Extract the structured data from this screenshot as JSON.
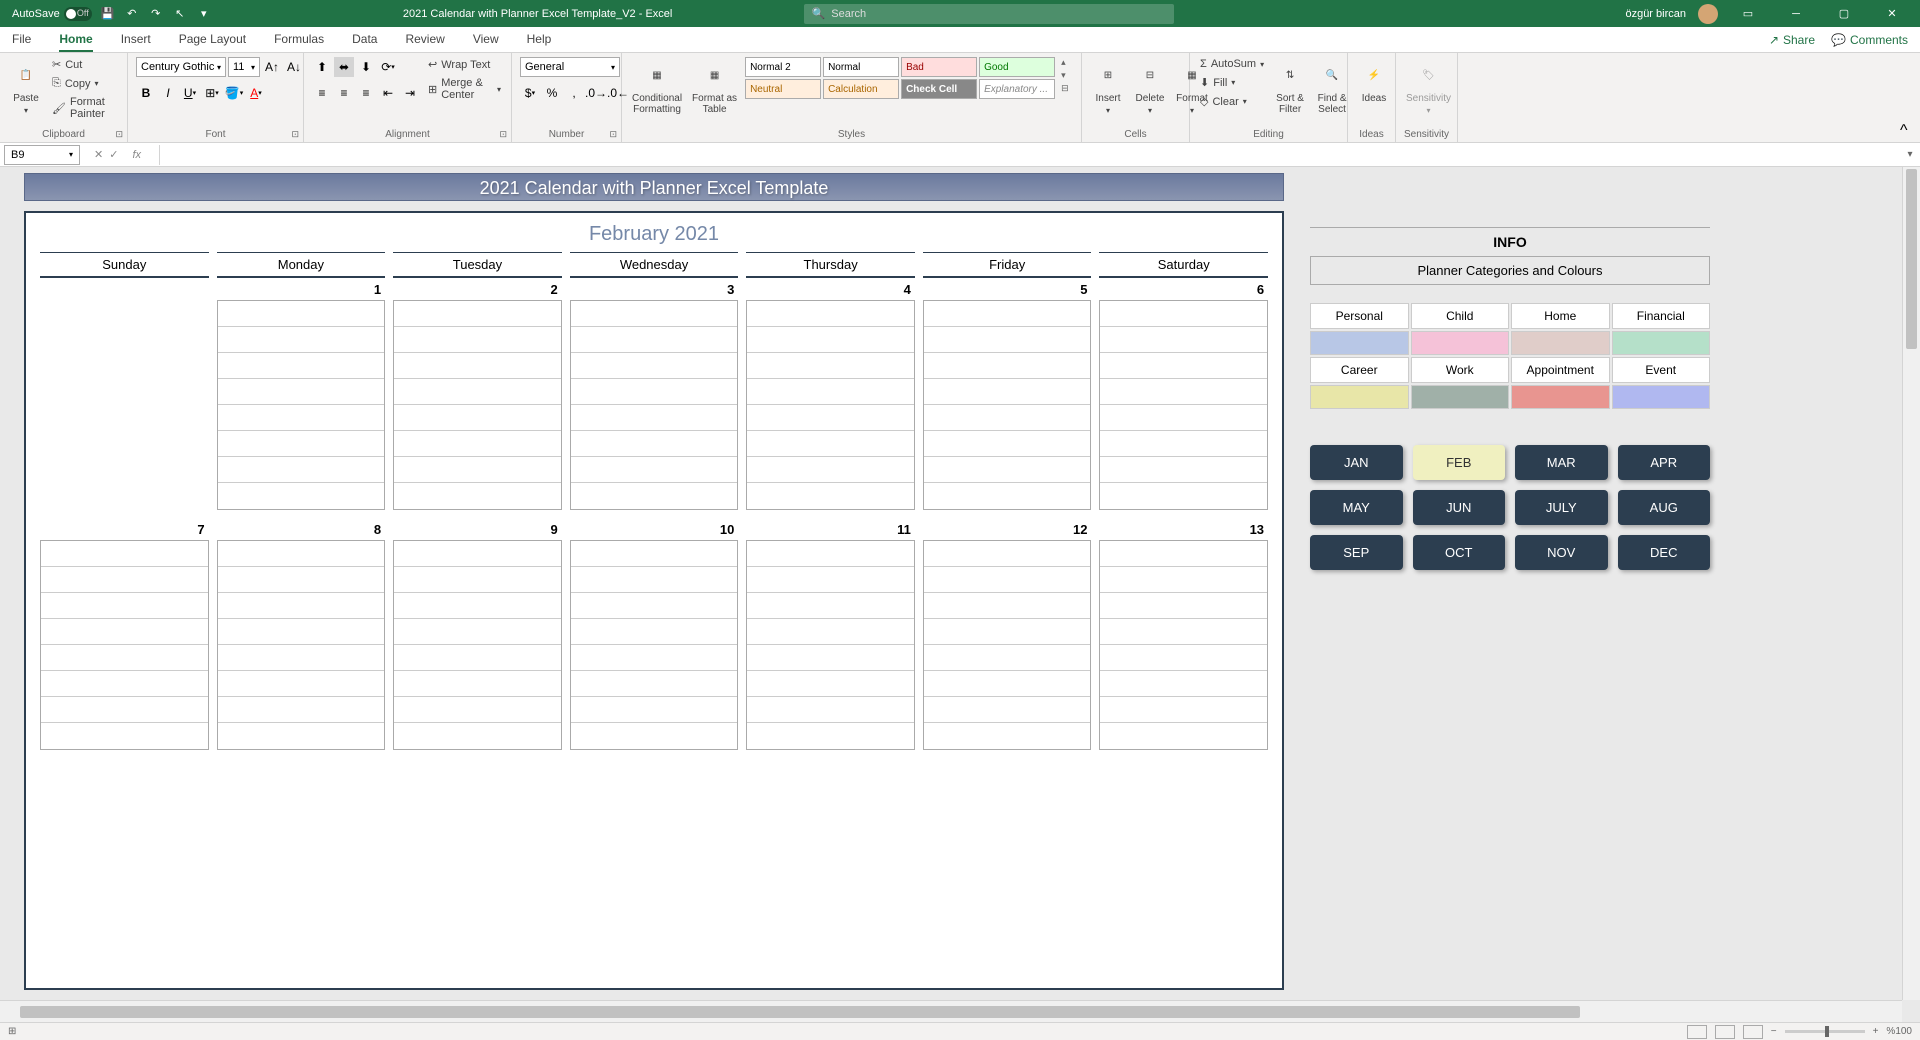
{
  "title_bar": {
    "autosave": "AutoSave",
    "autosave_state": "Off",
    "doc_title": "2021 Calendar with Planner Excel Template_V2  -  Excel",
    "search_placeholder": "Search",
    "username": "özgür bircan"
  },
  "menu": {
    "tabs": [
      "File",
      "Home",
      "Insert",
      "Page Layout",
      "Formulas",
      "Data",
      "Review",
      "View",
      "Help"
    ],
    "active": "Home",
    "share": "Share",
    "comments": "Comments"
  },
  "ribbon": {
    "clipboard": {
      "label": "Clipboard",
      "paste": "Paste",
      "cut": "Cut",
      "copy": "Copy",
      "format_painter": "Format Painter"
    },
    "font": {
      "label": "Font",
      "name": "Century Gothic",
      "size": "11"
    },
    "alignment": {
      "label": "Alignment",
      "wrap": "Wrap Text",
      "merge": "Merge & Center"
    },
    "number": {
      "label": "Number",
      "format": "General"
    },
    "styles": {
      "label": "Styles",
      "conditional": "Conditional\nFormatting",
      "table": "Format as\nTable",
      "cells": [
        "Normal 2",
        "Normal",
        "Bad",
        "Good",
        "Neutral",
        "Calculation",
        "Check Cell",
        "Explanatory ..."
      ]
    },
    "cells": {
      "label": "Cells",
      "insert": "Insert",
      "delete": "Delete",
      "format": "Format"
    },
    "editing": {
      "label": "Editing",
      "autosum": "AutoSum",
      "fill": "Fill",
      "clear": "Clear",
      "sort": "Sort &\nFilter",
      "find": "Find &\nSelect"
    },
    "ideas": {
      "label": "Ideas",
      "ideas": "Ideas"
    },
    "sensitivity": {
      "label": "Sensitivity",
      "sensitivity": "Sensitivity"
    }
  },
  "formula_bar": {
    "cell_ref": "B9"
  },
  "template": {
    "title": "2021 Calendar with Planner Excel Template",
    "month": "February 2021",
    "days": [
      "Sunday",
      "Monday",
      "Tuesday",
      "Wednesday",
      "Thursday",
      "Friday",
      "Saturday"
    ],
    "week1": [
      "",
      "1",
      "2",
      "3",
      "4",
      "5",
      "6"
    ],
    "week2": [
      "7",
      "8",
      "9",
      "10",
      "11",
      "12",
      "13"
    ]
  },
  "info": {
    "title": "INFO",
    "subtitle": "Planner Categories and Colours",
    "categories": [
      {
        "name": "Personal",
        "color": "#b8c7e6"
      },
      {
        "name": "Child",
        "color": "#f5c2d8"
      },
      {
        "name": "Home",
        "color": "#e0cdc9"
      },
      {
        "name": "Financial",
        "color": "#b5e0c9"
      },
      {
        "name": "Career",
        "color": "#e8e6a8"
      },
      {
        "name": "Work",
        "color": "#a0b0a8"
      },
      {
        "name": "Appointment",
        "color": "#e89590"
      },
      {
        "name": "Event",
        "color": "#b0b8f0"
      }
    ],
    "months": [
      "JAN",
      "FEB",
      "MAR",
      "APR",
      "MAY",
      "JUN",
      "JULY",
      "AUG",
      "SEP",
      "OCT",
      "NOV",
      "DEC"
    ],
    "active_month": "FEB"
  },
  "status": {
    "zoom": "%100"
  }
}
